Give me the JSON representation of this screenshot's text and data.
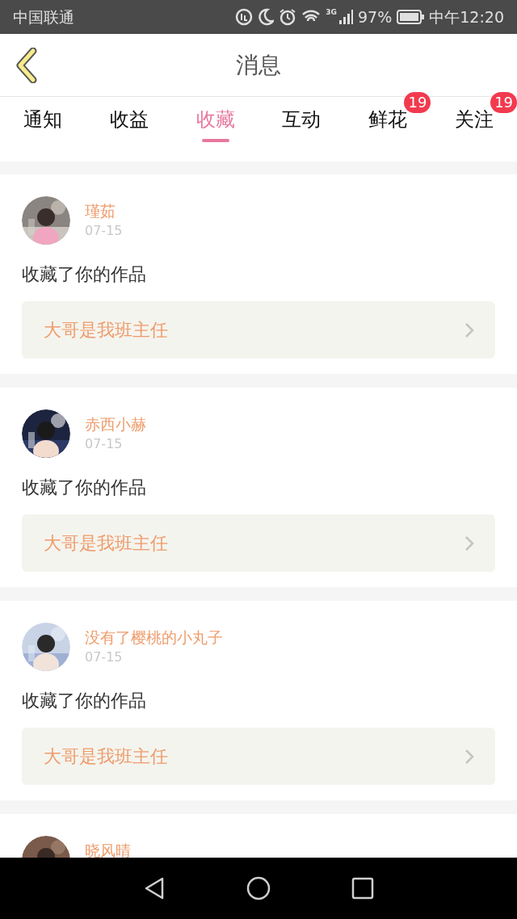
{
  "status_bar": {
    "carrier": "中国联通",
    "network": "3G",
    "battery": "97%",
    "time": "中午12:20"
  },
  "header": {
    "title": "消息"
  },
  "tabs": [
    {
      "label": "通知",
      "selected": false
    },
    {
      "label": "收益",
      "selected": false
    },
    {
      "label": "收藏",
      "selected": true
    },
    {
      "label": "互动",
      "selected": false
    },
    {
      "label": "鲜花",
      "selected": false,
      "badge": "19"
    },
    {
      "label": "关注",
      "selected": false,
      "badge": "19"
    }
  ],
  "messages": [
    {
      "name": "瑾茹",
      "date": "07-15",
      "text": "收藏了你的作品",
      "work": "大哥是我班主任"
    },
    {
      "name": "赤西小赫",
      "date": "07-15",
      "text": "收藏了你的作品",
      "work": "大哥是我班主任"
    },
    {
      "name": "没有了樱桃的小丸子",
      "date": "07-15",
      "text": "收藏了你的作品",
      "work": "大哥是我班主任"
    },
    {
      "name": "晓风晴"
    }
  ]
}
